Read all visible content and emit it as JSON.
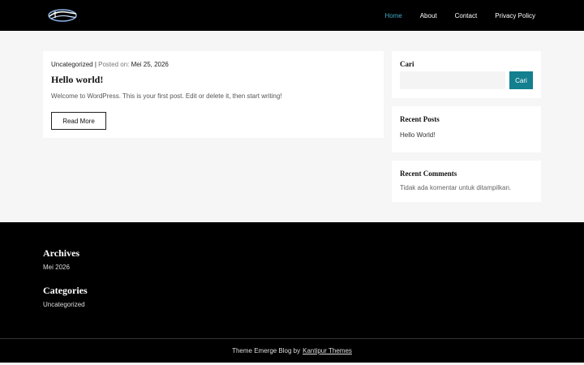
{
  "header": {
    "logo_icon": "site-logo",
    "nav": [
      {
        "label": "Home",
        "active": true
      },
      {
        "label": "About",
        "active": false
      },
      {
        "label": "Contact",
        "active": false
      },
      {
        "label": "Privacy Policy",
        "active": false
      }
    ],
    "active_color": "#3fa9c4"
  },
  "post": {
    "category": "Uncategorized",
    "separator": "|",
    "posted_label": "Posted on:",
    "date": "Mei 25, 2026",
    "title": "Hello world!",
    "excerpt": "Welcome to WordPress. This is your first post. Edit or delete it, then start writing!",
    "read_more": "Read More"
  },
  "sidebar": {
    "search": {
      "title": "Cari",
      "placeholder": "",
      "button": "Cari",
      "button_color": "#137f8f"
    },
    "recent_posts": {
      "title": "Recent Posts",
      "items": [
        "Hello World!"
      ]
    },
    "recent_comments": {
      "title": "Recent Comments",
      "empty_text": "Tidak ada komentar untuk ditampilkan."
    }
  },
  "footer": {
    "archives": {
      "title": "Archives",
      "items": [
        "Mei 2026"
      ]
    },
    "categories": {
      "title": "Categories",
      "items": [
        "Uncategorized"
      ]
    },
    "credit": {
      "text": "Theme Emerge Blog by",
      "link": "Kantipur Themes"
    }
  }
}
